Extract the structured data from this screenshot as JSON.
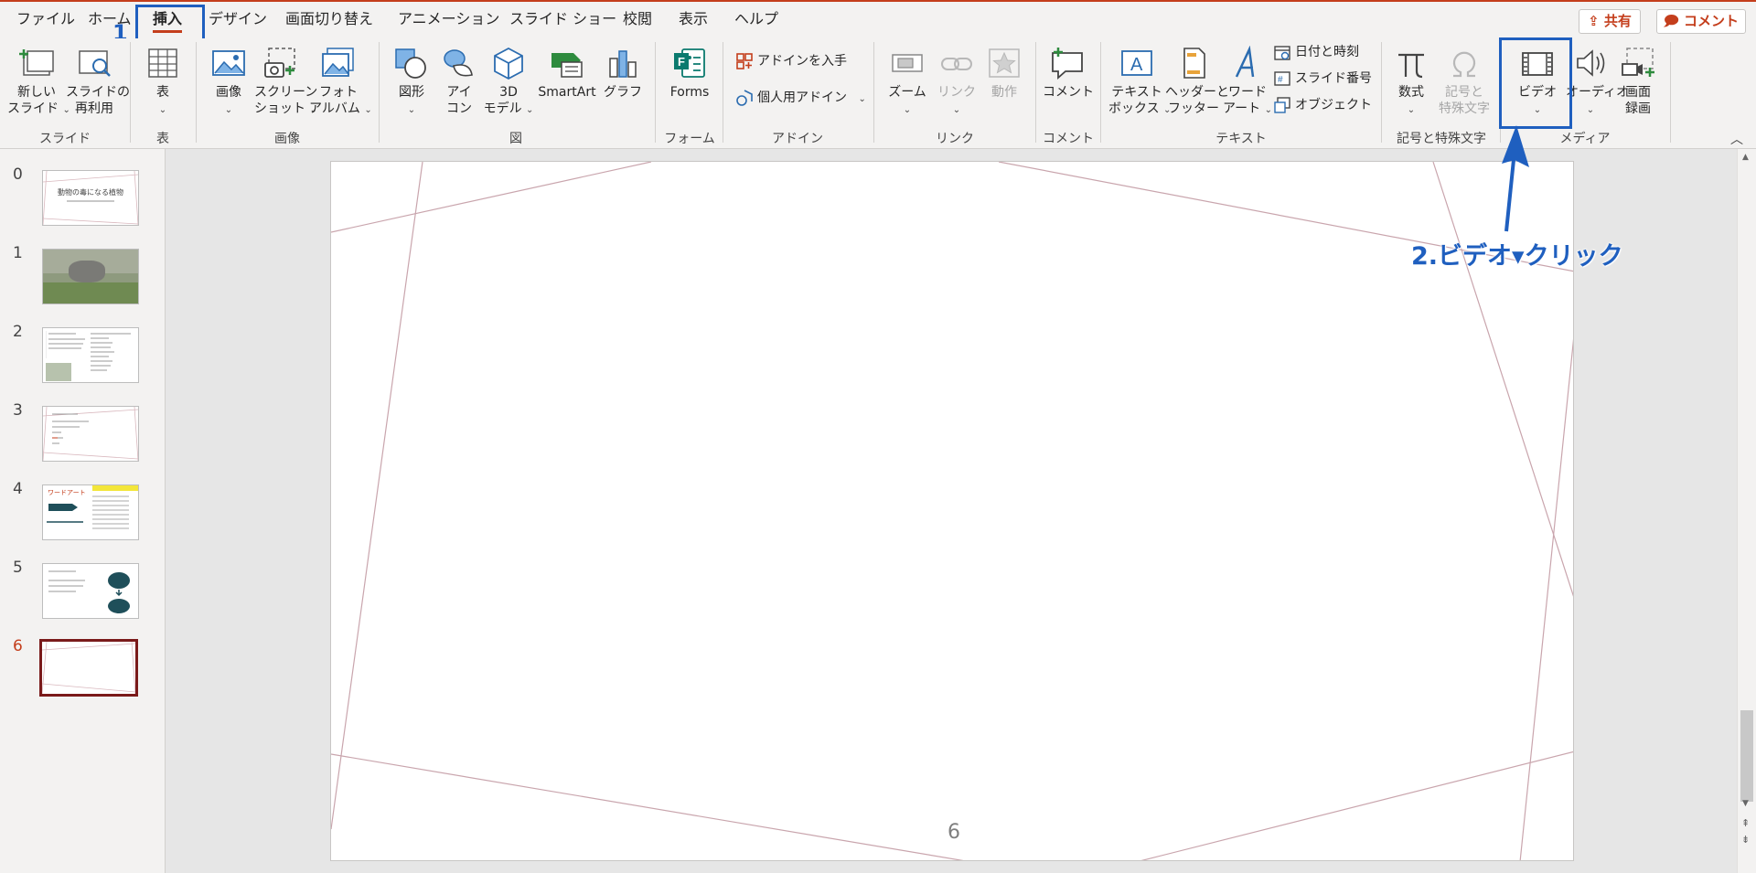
{
  "tabs": [
    {
      "label": "ファイル",
      "active": false
    },
    {
      "label": "ホーム",
      "active": false
    },
    {
      "label": "挿入",
      "active": true
    },
    {
      "label": "デザイン",
      "active": false
    },
    {
      "label": "画面切り替え",
      "active": false
    },
    {
      "label": "アニメーション",
      "active": false
    },
    {
      "label": "スライド ショー",
      "active": false
    },
    {
      "label": "校閲",
      "active": false
    },
    {
      "label": "表示",
      "active": false
    },
    {
      "label": "ヘルプ",
      "active": false
    }
  ],
  "share_label": "共有",
  "comment_label": "コメント",
  "ribbon": {
    "slides": {
      "new_slide": [
        "新しい",
        "スライド"
      ],
      "reuse": [
        "スライドの",
        "再利用"
      ],
      "group": "スライド"
    },
    "table": {
      "table": "表",
      "group": "表"
    },
    "images": {
      "image": "画像",
      "screenshot": [
        "スクリーン",
        "ショット"
      ],
      "photo_album": [
        "フォト",
        "アルバム"
      ],
      "group": "画像"
    },
    "illustrations": {
      "shapes": "図形",
      "icons": [
        "アイ",
        "コン"
      ],
      "model3d": [
        "3D",
        "モデル"
      ],
      "smartart": "SmartArt",
      "chart": "グラフ",
      "group": "図"
    },
    "forms": {
      "forms": "Forms",
      "group": "フォーム"
    },
    "addins": {
      "get": "アドインを入手",
      "personal": "個人用アドイン",
      "group": "アドイン"
    },
    "links": {
      "zoom": "ズーム",
      "link": "リンク",
      "action": "動作",
      "group": "リンク"
    },
    "comments": {
      "comment": "コメント",
      "group": "コメント"
    },
    "text": {
      "textbox": [
        "テキスト",
        "ボックス"
      ],
      "headerfooter": [
        "ヘッダーと",
        "フッター"
      ],
      "wordart": [
        "ワード",
        "アート"
      ],
      "datetime": "日付と時刻",
      "slidenum": "スライド番号",
      "object": "オブジェクト",
      "group": "テキスト"
    },
    "symbols": {
      "equation": "数式",
      "symbol": [
        "記号と",
        "特殊文字"
      ],
      "group": "記号と特殊文字"
    },
    "media": {
      "video": "ビデオ",
      "audio": "オーディオ",
      "screenrec": [
        "画面",
        "録画"
      ],
      "group": "メディア"
    }
  },
  "thumbnails": [
    {
      "num": "0",
      "title": "動物の毒になる植物",
      "selected": false
    },
    {
      "num": "1",
      "selected": false
    },
    {
      "num": "2",
      "selected": false
    },
    {
      "num": "3",
      "selected": false
    },
    {
      "num": "4",
      "label": "ワードアート",
      "selected": false
    },
    {
      "num": "5",
      "selected": false
    },
    {
      "num": "6",
      "selected": true
    }
  ],
  "slide_number": "6",
  "annotations": {
    "step1": "1",
    "step2": "2.ビデオ▾クリック"
  },
  "colors": {
    "accent": "#c43e1c",
    "annotation": "#1f5fbf",
    "selected_thumb_border": "#7a1a1a"
  }
}
